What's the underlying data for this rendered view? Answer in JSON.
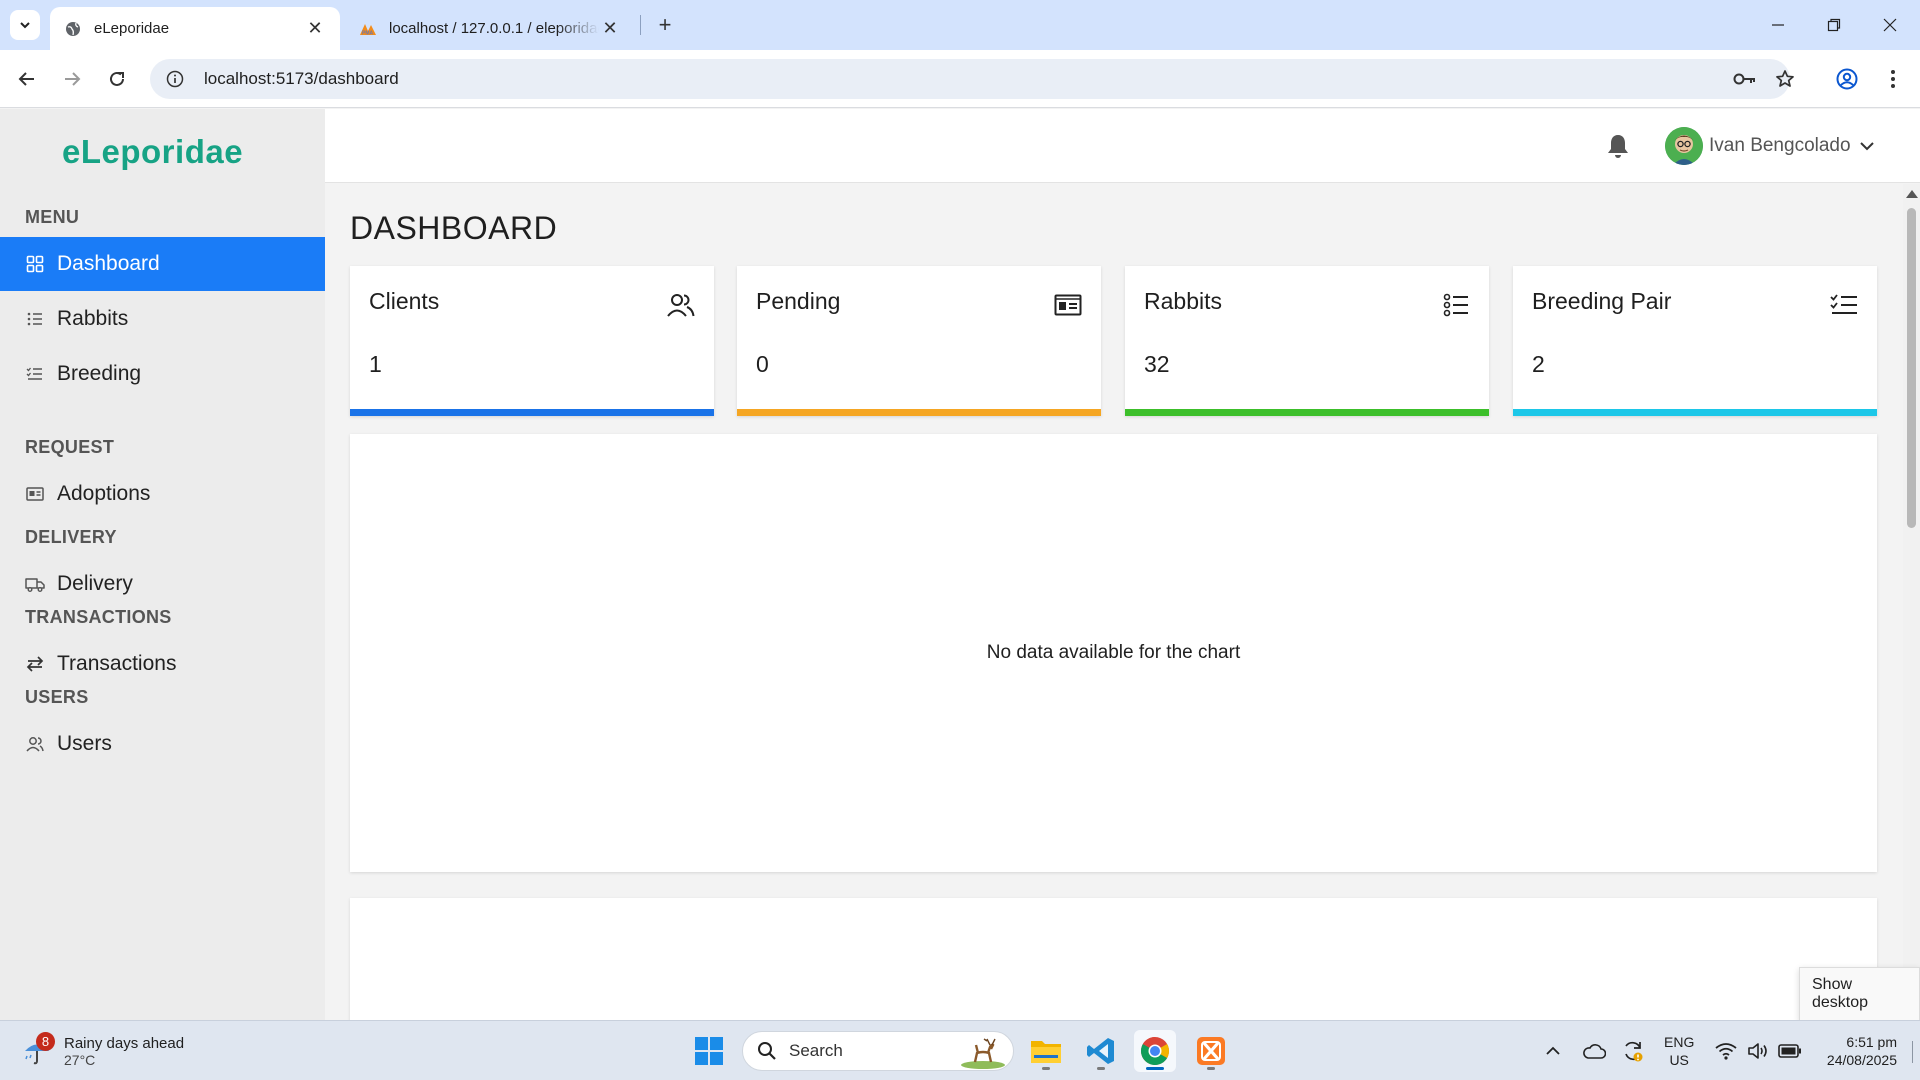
{
  "browser": {
    "tabs": [
      {
        "title": "eLeporidae",
        "active": true
      },
      {
        "title": "localhost / 127.0.0.1 / eleporidae",
        "active": false
      }
    ],
    "url": "localhost:5173/dashboard"
  },
  "app": {
    "logo": "eLeporidae",
    "sections": {
      "menu": "MENU",
      "request": "REQUEST",
      "delivery": "DELIVERY",
      "transactions": "TRANSACTIONS",
      "users": "USERS"
    },
    "nav": {
      "dashboard": "Dashboard",
      "rabbits": "Rabbits",
      "breeding": "Breeding",
      "adoptions": "Adoptions",
      "delivery": "Delivery",
      "transactions": "Transactions",
      "users": "Users"
    },
    "user": {
      "name": "Ivan Bengcolado"
    }
  },
  "dashboard": {
    "title": "DASHBOARD",
    "cards": [
      {
        "title": "Clients",
        "value": "1",
        "icon": "users-icon",
        "color": "#1a73e8"
      },
      {
        "title": "Pending",
        "value": "0",
        "icon": "id-card-icon",
        "color": "#f5a623"
      },
      {
        "title": "Rabbits",
        "value": "32",
        "icon": "list-icon",
        "color": "#3cbf2a"
      },
      {
        "title": "Breeding Pair",
        "value": "2",
        "icon": "checklist-icon",
        "color": "#1cc7e8"
      }
    ],
    "chart_empty_message": "No data available for the chart"
  },
  "tooltip": "Show desktop",
  "taskbar": {
    "weather": {
      "badge": "8",
      "text": "Rainy days ahead",
      "temp": "27°C"
    },
    "search_placeholder": "Search",
    "lang": {
      "line1": "ENG",
      "line2": "US"
    },
    "clock": {
      "time": "6:51 pm",
      "date": "24/08/2025"
    }
  },
  "colors": {
    "accent": "#1a7cf7",
    "logo": "#17a385"
  }
}
